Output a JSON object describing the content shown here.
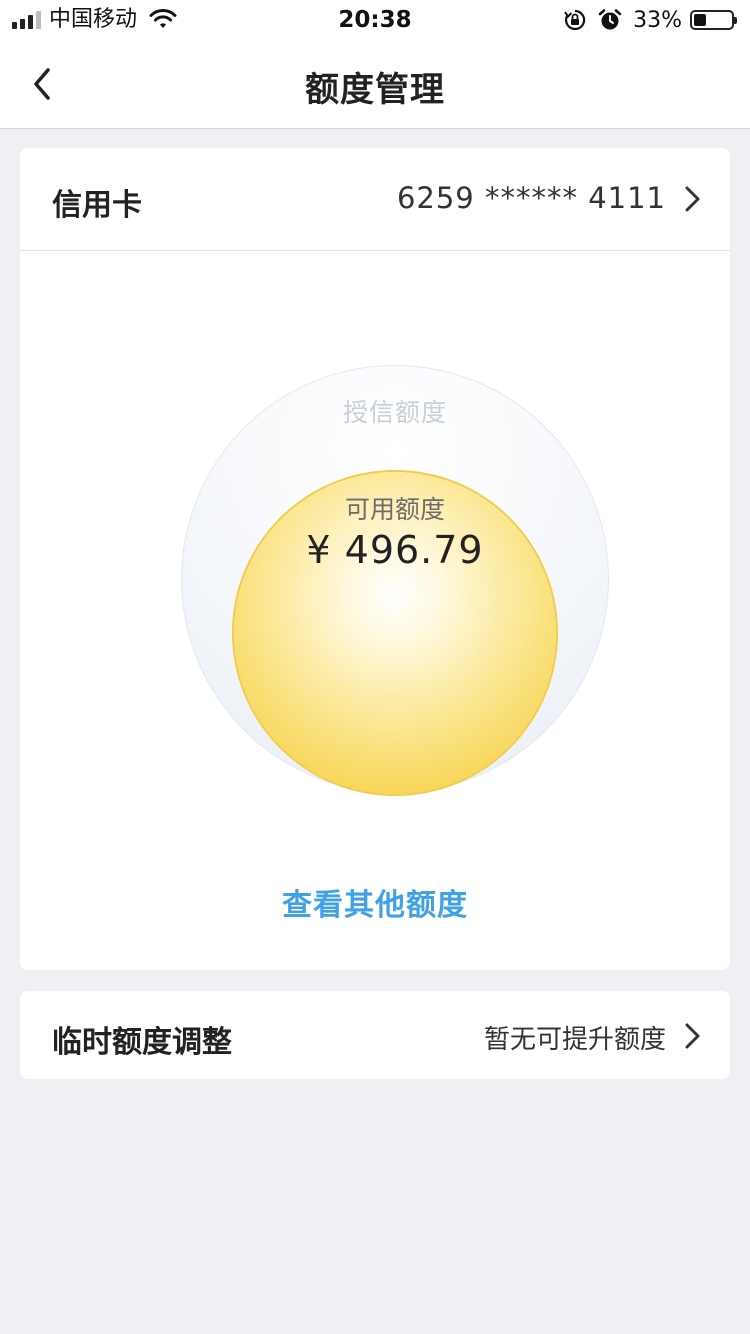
{
  "status_bar": {
    "carrier": "中国移动",
    "time": "20:38",
    "battery_percent": "33%",
    "battery_level": 0.33,
    "signal_bars_active": 3,
    "signal_bars_total": 4
  },
  "nav": {
    "title": "额度管理"
  },
  "card": {
    "label": "信用卡",
    "number": "6259 ****** 4111"
  },
  "quota": {
    "total_label": "授信额度",
    "available_label": "可用额度",
    "available_amount": "¥ 496.79"
  },
  "links": {
    "view_other": "查看其他额度"
  },
  "temp_adjust": {
    "label": "临时额度调整",
    "status": "暂无可提升额度"
  },
  "colors": {
    "accent_link": "#3fa1e6",
    "orb_yellow": "#f6d24a",
    "background": "#efeff4"
  }
}
